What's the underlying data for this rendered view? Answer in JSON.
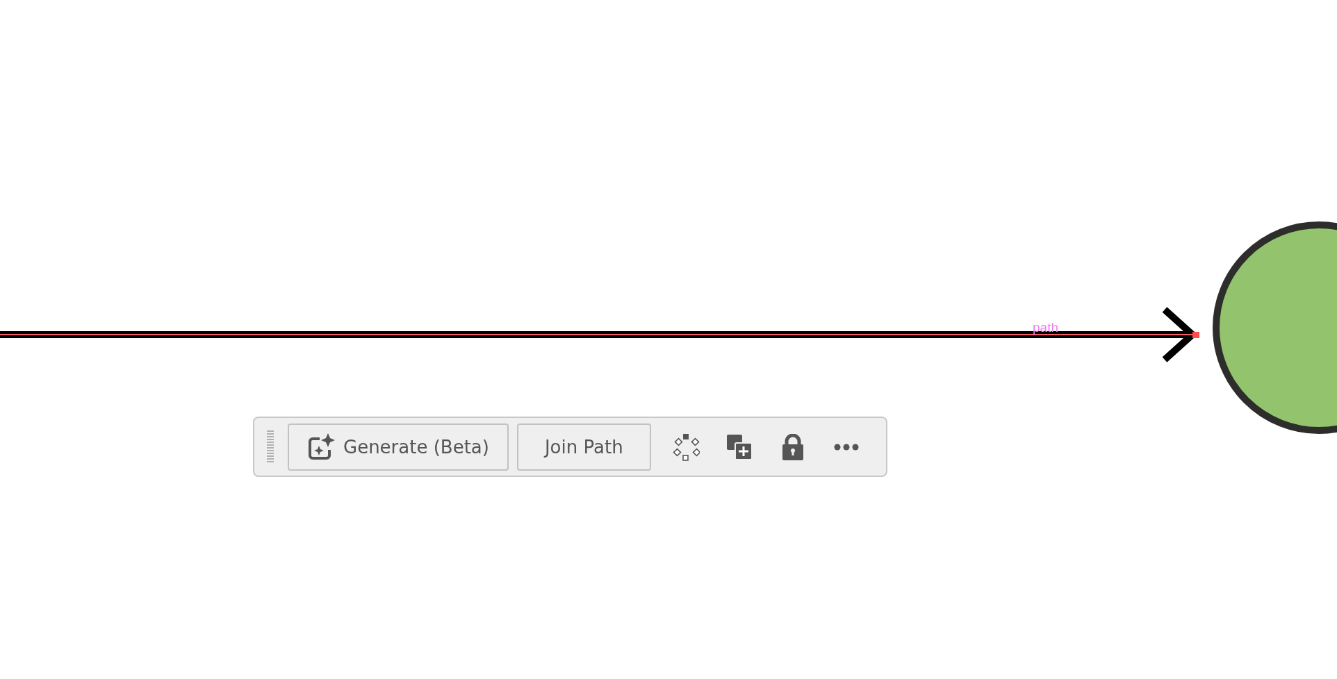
{
  "canvas": {
    "connector": {
      "label": "path",
      "selected": true
    }
  },
  "toolbar": {
    "buttons": [
      {
        "label": "Generate (Beta)"
      },
      {
        "label": "Join Path"
      }
    ]
  }
}
